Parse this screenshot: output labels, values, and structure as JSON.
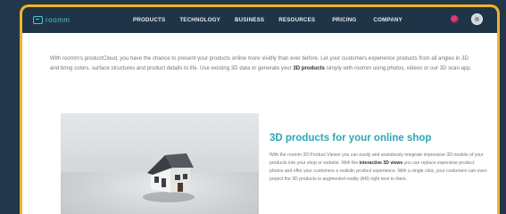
{
  "nav": {
    "logo_text": "roomm",
    "items": [
      "PRODUCTS",
      "TECHNOLOGY",
      "BUSINESS",
      "RESOURCES",
      "PRICING",
      "COMPANY"
    ],
    "language_icon": "flag-icon",
    "account_icon": "user-avatar-icon"
  },
  "intro": {
    "p1": "With roomm's productCloud, you have the chance to present your products online more vividly than ever before. Let your customers experience products from all angles in 3D and bring colors, surface structures and product details to life. Use existing 3D data or generate your ",
    "bold": "3D products",
    "p2": " simply with roomm using photos, videos or our 3D scan app."
  },
  "feature": {
    "title": "3D products for your online shop",
    "p1": "With the roomm 3D Product Viewer you can easily and seamlessly integrate impressive 3D models of your products into your shop or website. With the ",
    "bold": "interactive 3D views",
    "p2": " you can replace expensive product photos and offer your customers a realistic product experience. With a single click, your customers can even project the 3D products in augmented reality (AR) right next to them."
  },
  "colors": {
    "accent_border": "#f0b429",
    "nav_bg": "#1f3547",
    "heading": "#2ba8b6"
  }
}
